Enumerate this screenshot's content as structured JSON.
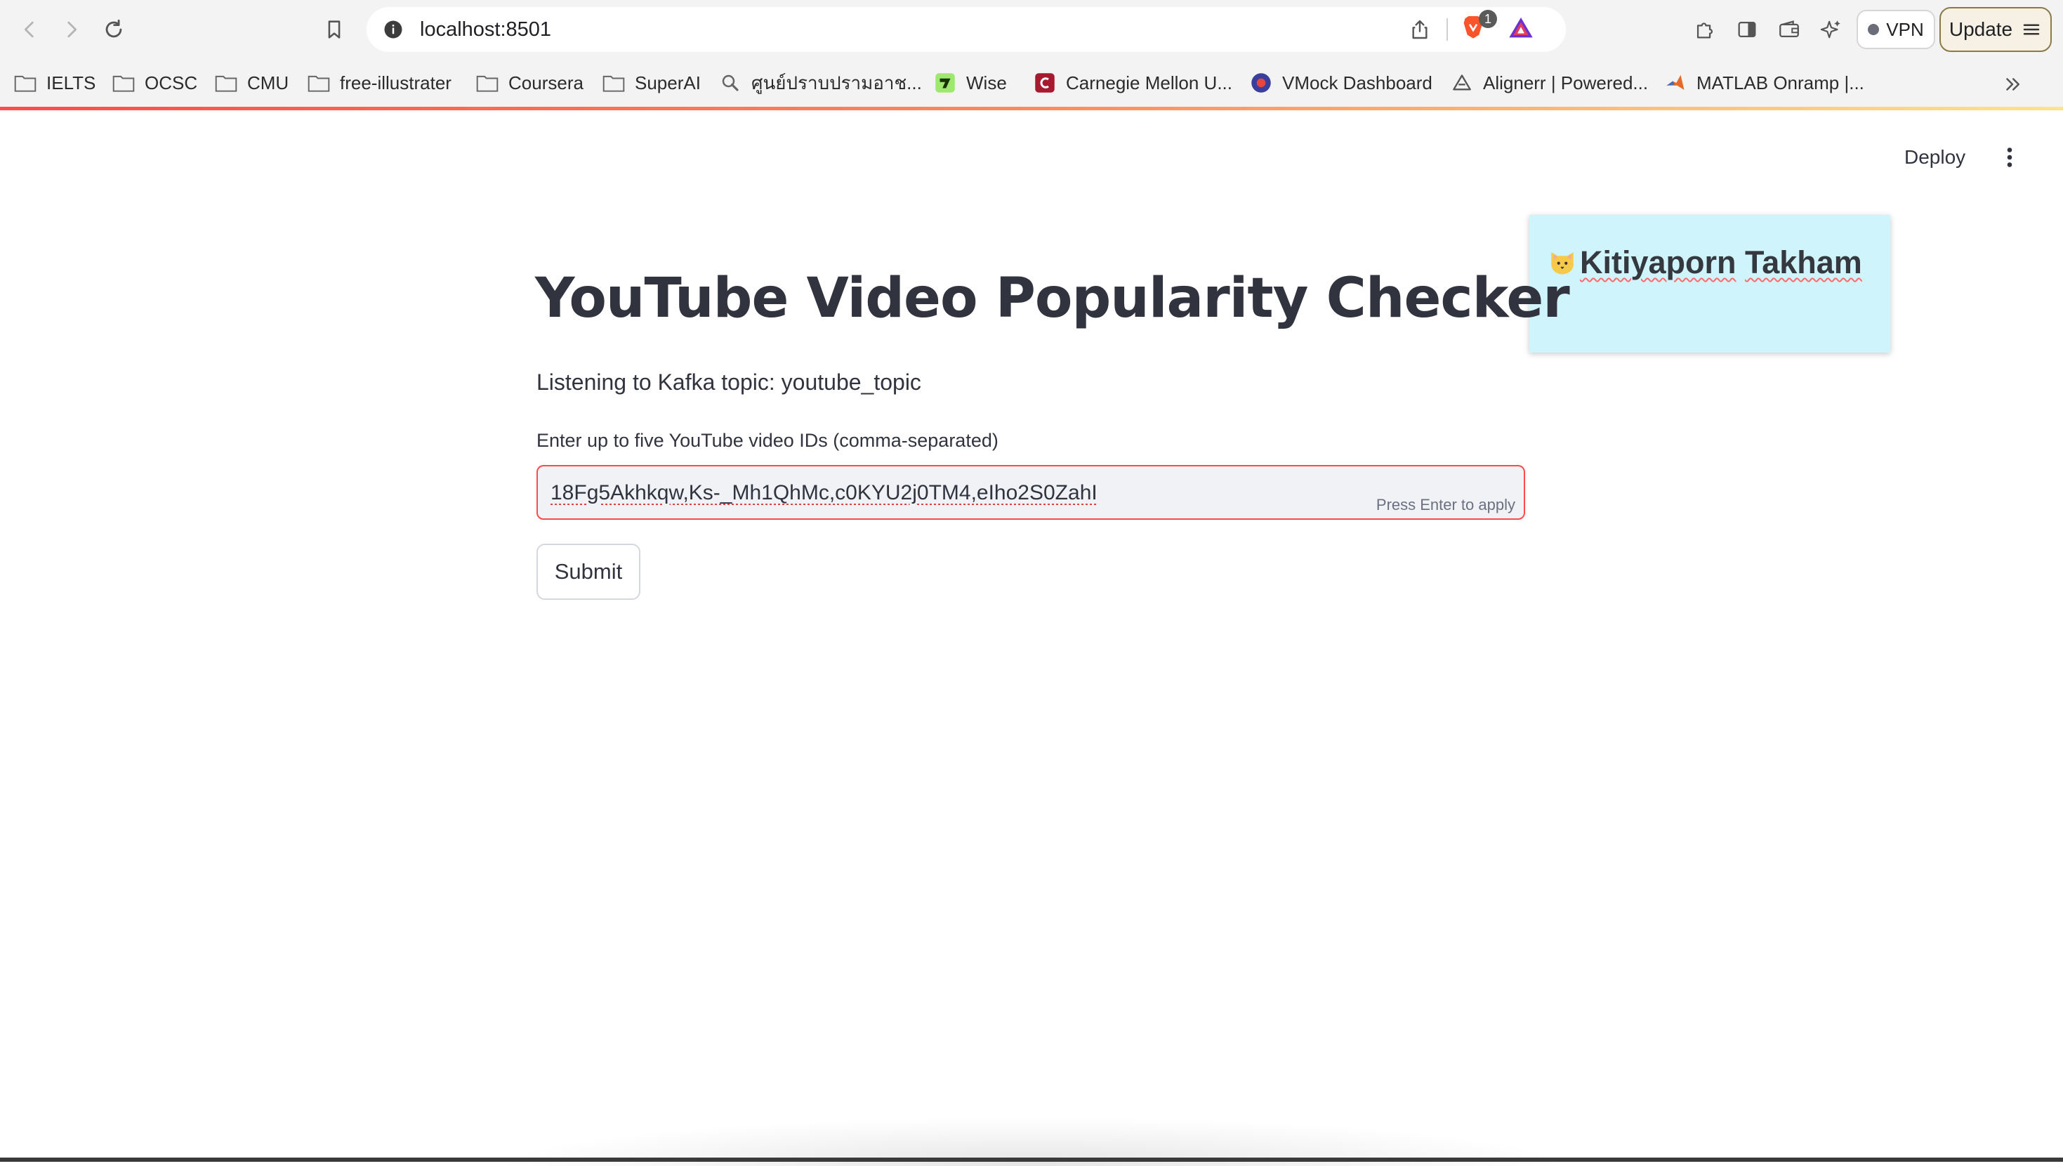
{
  "browser": {
    "url": "localhost:8501",
    "shield_count": "1",
    "vpn_label": "VPN",
    "update_label": "Update"
  },
  "bookmarks": [
    {
      "label": "IELTS",
      "icon": "folder-icon"
    },
    {
      "label": "OCSC",
      "icon": "folder-icon"
    },
    {
      "label": "CMU",
      "icon": "folder-icon"
    },
    {
      "label": "free-illustrater",
      "icon": "folder-icon"
    },
    {
      "label": "Coursera",
      "icon": "folder-icon"
    },
    {
      "label": "SuperAI",
      "icon": "folder-icon"
    },
    {
      "label": "ศูนย์ปราบปรามอาช...",
      "icon": "magnifier-icon"
    },
    {
      "label": "Wise",
      "icon": "wise-icon"
    },
    {
      "label": "Carnegie Mellon U...",
      "icon": "cmu-icon"
    },
    {
      "label": "VMock Dashboard",
      "icon": "vmock-icon"
    },
    {
      "label": "Alignerr | Powered...",
      "icon": "alignerr-icon"
    },
    {
      "label": "MATLAB Onramp |...",
      "icon": "matlab-icon"
    }
  ],
  "app": {
    "deploy_label": "Deploy",
    "title": "YouTube Video Popularity Checker",
    "subtitle": "Listening to Kafka topic: youtube_topic",
    "input_label": "Enter up to five YouTube video IDs (comma-separated)",
    "input_value": "18Fg5Akhkqw,Ks-_Mh1QhMc,c0KYU2j0TM4,eIho2S0ZahI",
    "input_hint": "Press Enter to apply",
    "submit_label": "Submit",
    "author_emoji": "cat-face-icon",
    "author_first": "Kitiyaporn",
    "author_last": "Takham"
  },
  "colors": {
    "accent": "#ff4b4b",
    "card_bg": "#cff4fc",
    "text": "#31333f"
  }
}
